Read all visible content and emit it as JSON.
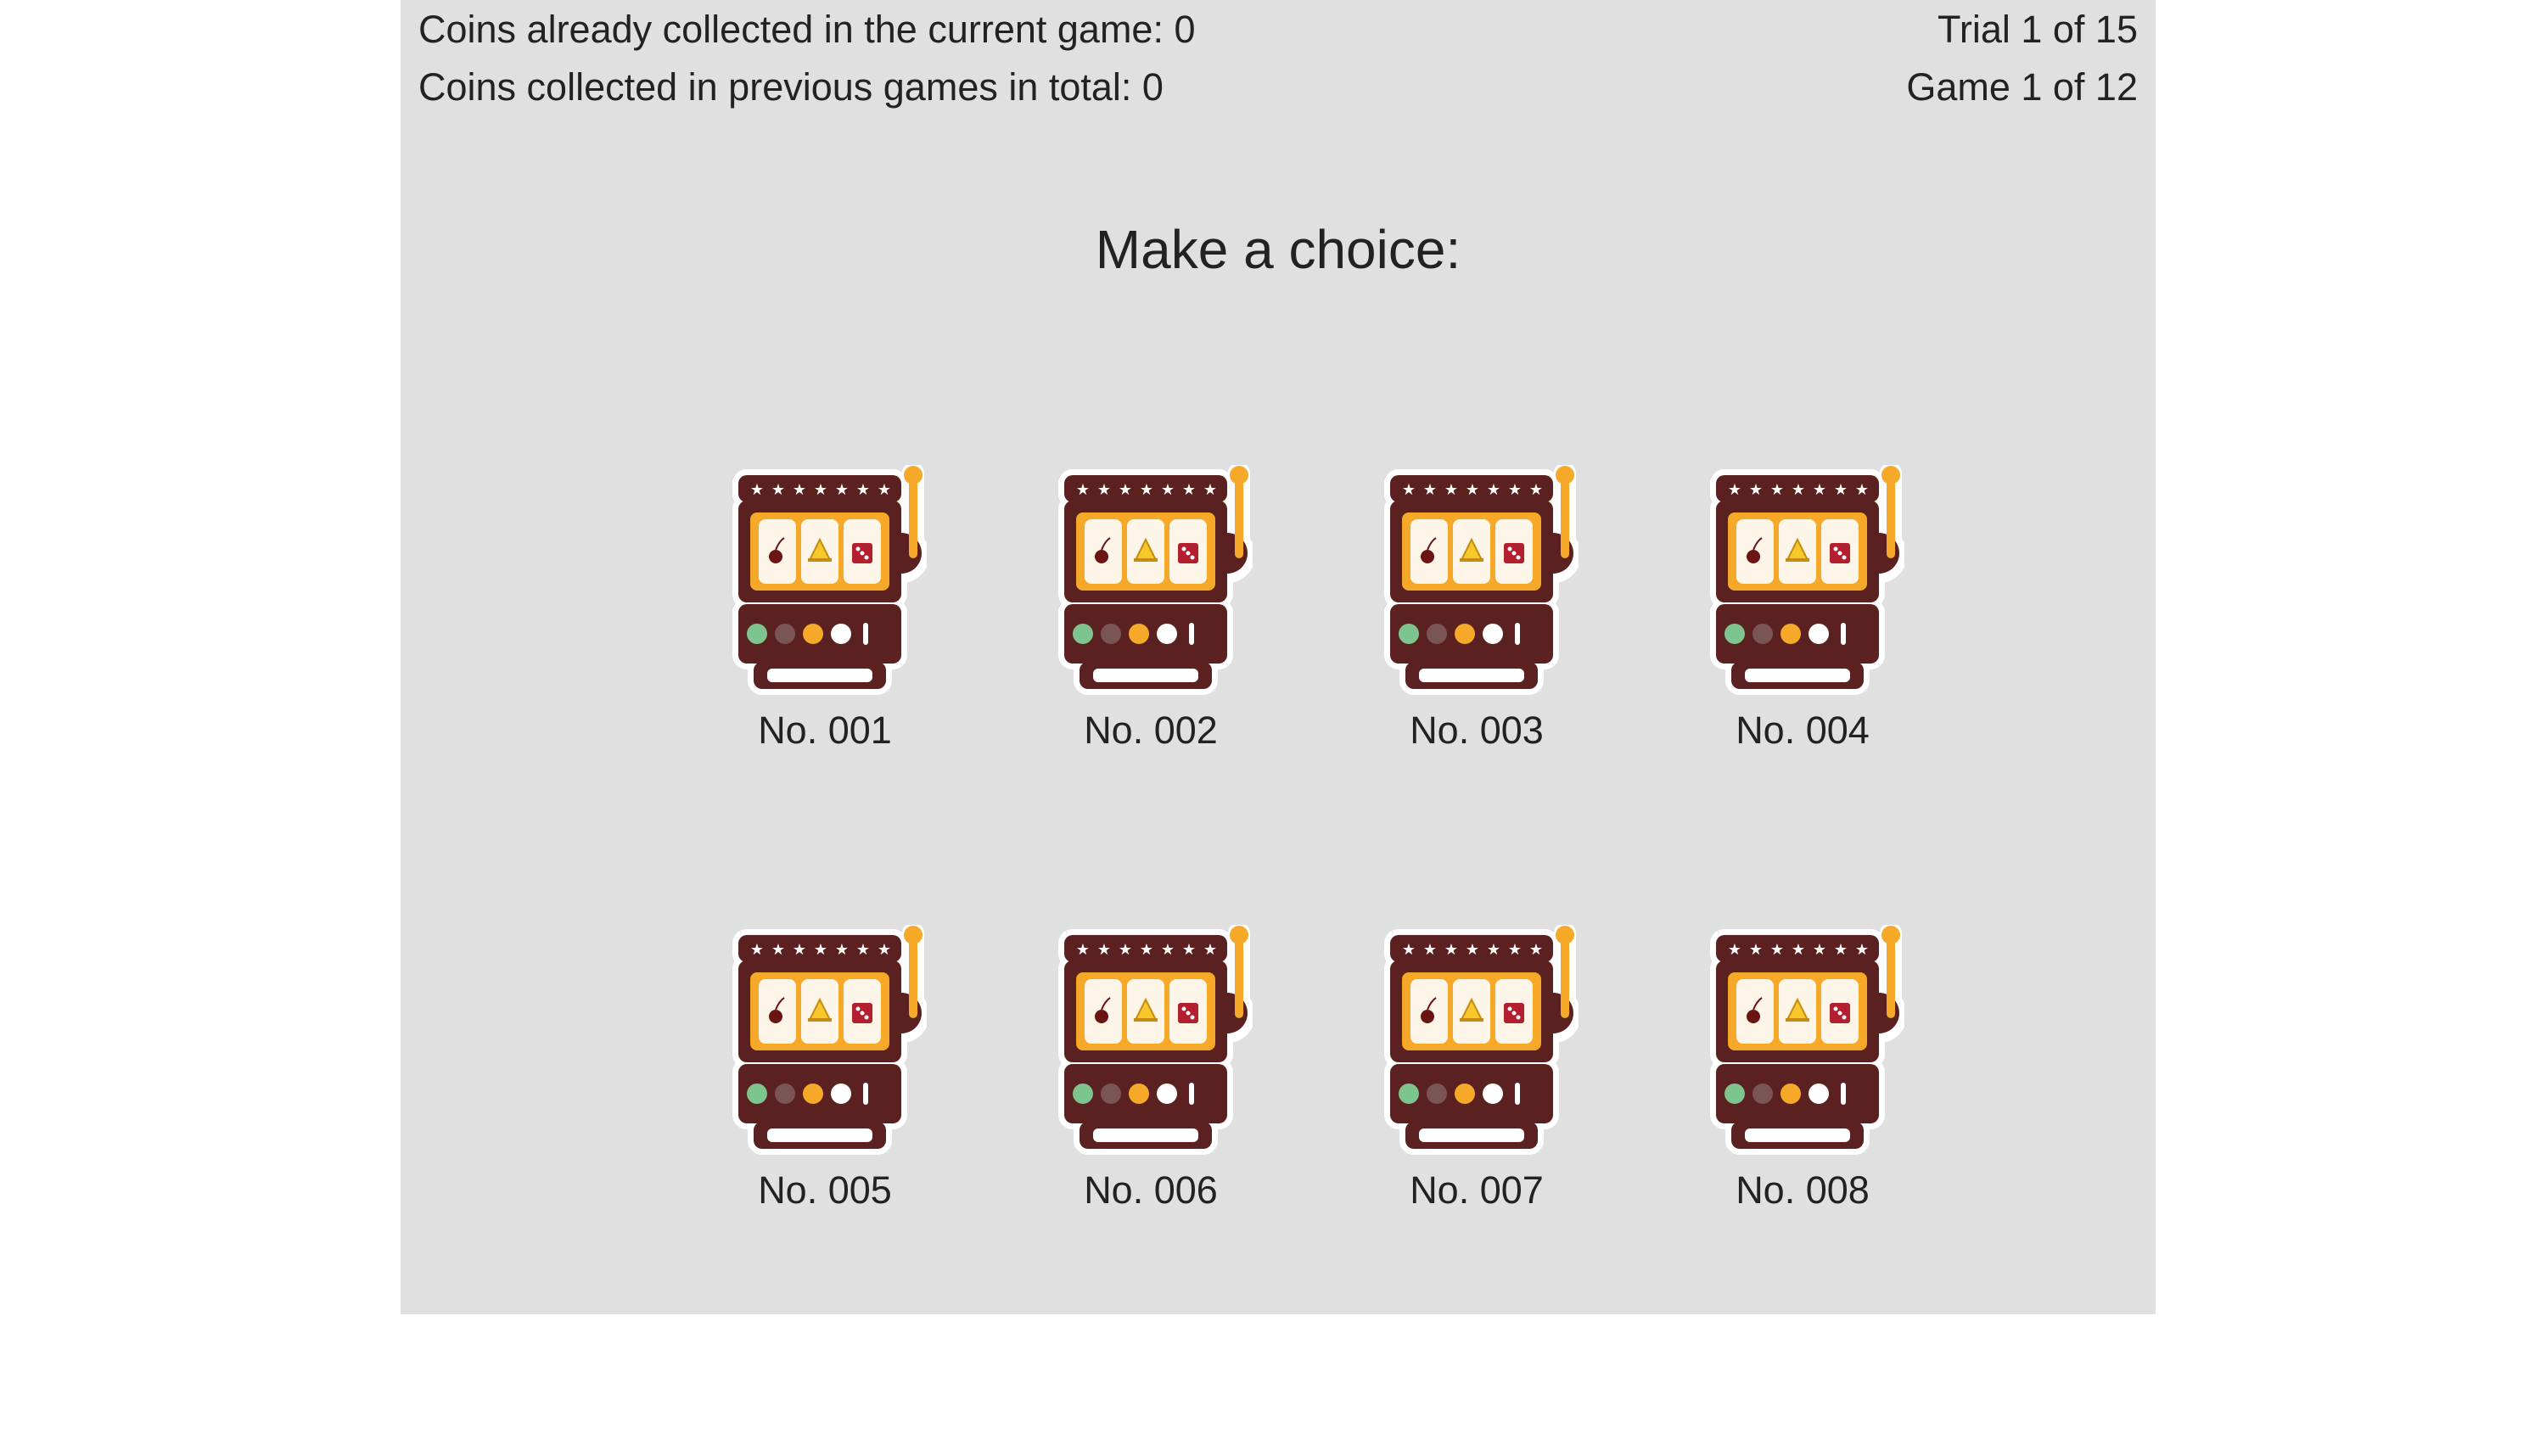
{
  "status": {
    "coins_current": "Coins already collected in the current game: 0",
    "coins_previous": "Coins collected in previous games in total: 0",
    "trial": "Trial 1 of 15",
    "game": "Game 1 of 12"
  },
  "prompt": "Make a choice:",
  "machines": [
    {
      "label": "No. 001",
      "icon": "slot-machine-icon"
    },
    {
      "label": "No. 002",
      "icon": "slot-machine-icon"
    },
    {
      "label": "No. 003",
      "icon": "slot-machine-icon"
    },
    {
      "label": "No. 004",
      "icon": "slot-machine-icon"
    },
    {
      "label": "No. 005",
      "icon": "slot-machine-icon"
    },
    {
      "label": "No. 006",
      "icon": "slot-machine-icon"
    },
    {
      "label": "No. 007",
      "icon": "slot-machine-icon"
    },
    {
      "label": "No. 008",
      "icon": "slot-machine-icon"
    }
  ],
  "colors": {
    "panel_background": "#e0e0e0",
    "machine_body": "#5b2120",
    "machine_accent": "#f6a928",
    "reel_window": "#fdf6e8",
    "light_green": "#7ec48f",
    "light_grey": "#7a5555",
    "light_orange": "#f6a928",
    "light_white": "#ffffff"
  }
}
